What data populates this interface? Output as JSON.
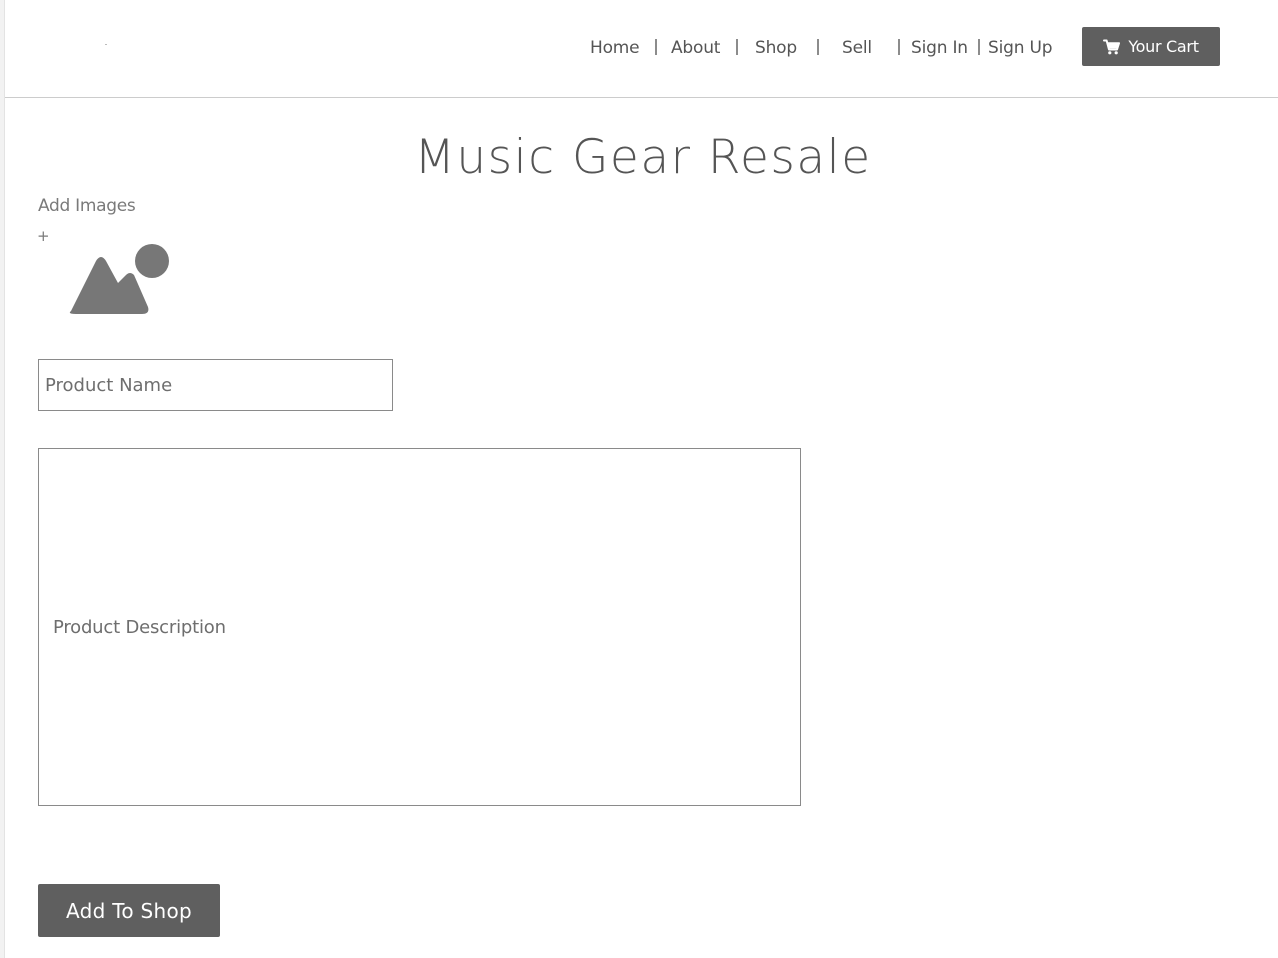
{
  "nav": {
    "items": [
      {
        "label": "Home"
      },
      {
        "label": "About"
      },
      {
        "label": "Shop"
      },
      {
        "label": "Sell"
      },
      {
        "label": "Sign In"
      },
      {
        "label": "Sign Up"
      }
    ],
    "cart_label": "Your Cart",
    "cart_icon": "shopping-cart-icon"
  },
  "page": {
    "title": "Music Gear Resale"
  },
  "form": {
    "add_images_label": "Add Images",
    "add_images_plus": "+",
    "image_icon": "image-placeholder-icon",
    "product_name_placeholder": "Product Name",
    "product_description_placeholder": "Product Description",
    "submit_label": "Add To Shop"
  },
  "colors": {
    "button_bg": "#5f5f5f",
    "text": "#555555",
    "border": "#8a8a8a",
    "icon_fill": "#777777"
  }
}
